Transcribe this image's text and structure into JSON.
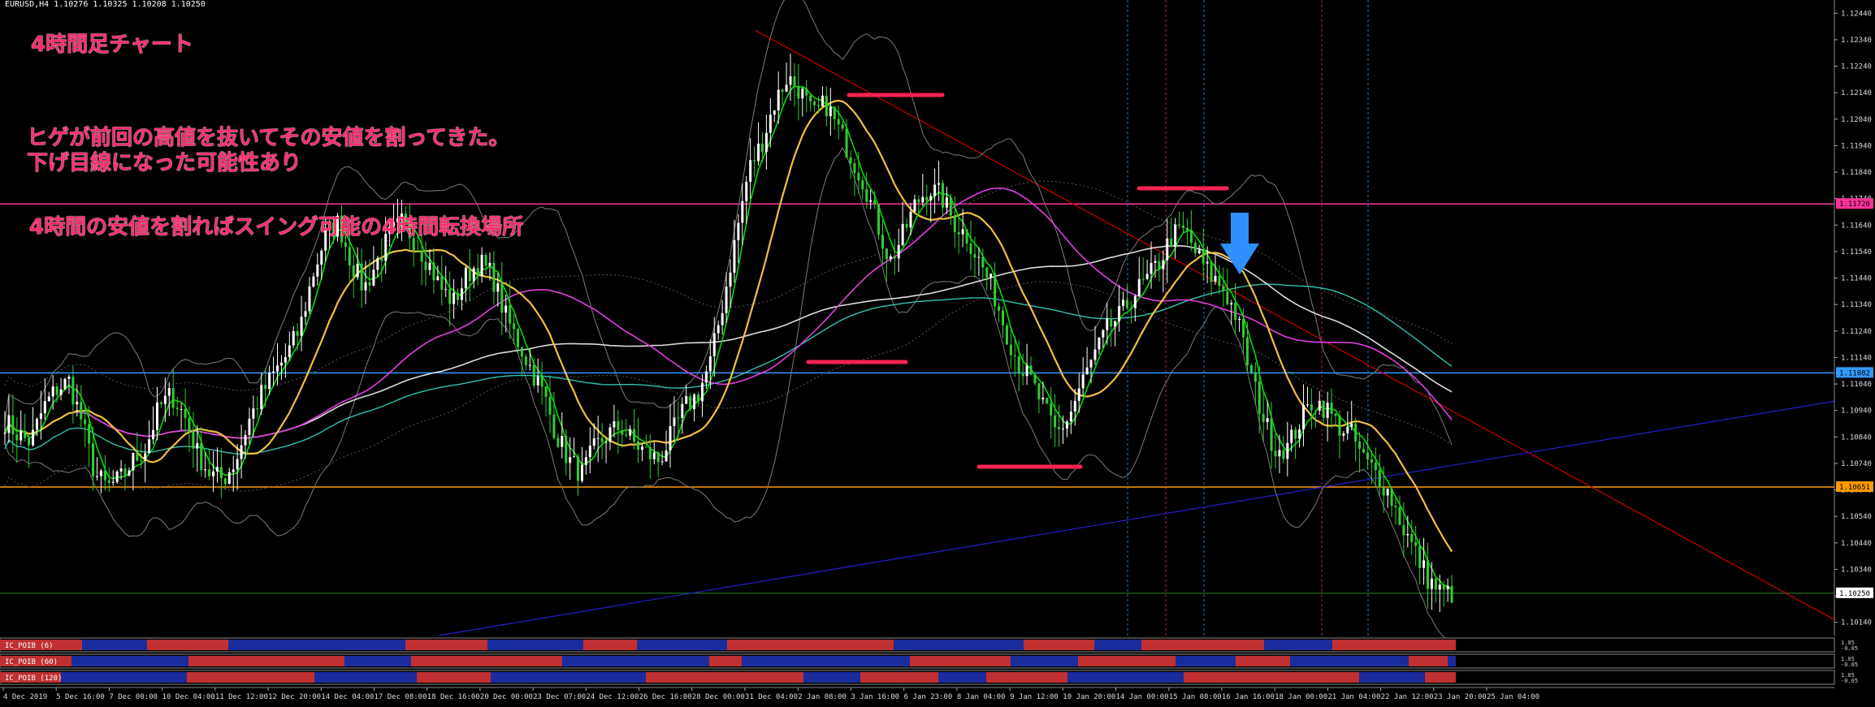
{
  "header": {
    "symbol_line": "EURUSD,H4  1.10276 1.10325 1.10208 1.10250"
  },
  "annotations": {
    "title": "4時間足チャート",
    "line1": "ヒゲが前回の高値を抜いてその安値を割ってきた。",
    "line2": "下げ目線になった可能性あり",
    "line3": "4時間の安値を割ればスイング可能の4時間転換場所"
  },
  "colors": {
    "bull": "#ffffff",
    "bear": "#33cc33",
    "ma_fast": "#00dd00",
    "ma_mid": "#f0c040",
    "ma_magenta": "#e040e0",
    "ma_white": "#dddddd",
    "ma_teal": "#30c0b0",
    "band": "#7a7a7a",
    "level_pink": "#ff3399",
    "level_blue": "#3399ff",
    "level_orange": "#ff9900",
    "trend_red": "#cc0000",
    "trend_blue": "#2222cc",
    "marker": "#ff2255",
    "arrow": "#2f8fff",
    "grid_dash_blue": "#2277bb",
    "grid_dash_red": "#bb2244",
    "indicator_red": "#c03030",
    "indicator_blue": "#1a2c9c"
  },
  "price_levels": [
    {
      "label": "1.11720",
      "color": "#ff3399"
    },
    {
      "label": "1.11082",
      "color": "#3399ff"
    },
    {
      "label": "1.10651",
      "color": "#ff9900"
    },
    {
      "label": "1.10250",
      "color": "#ffffff"
    }
  ],
  "y_ticks": [
    "1.12440",
    "1.12340",
    "1.12240",
    "1.12140",
    "1.12040",
    "1.11940",
    "1.11840",
    "1.11740",
    "1.11640",
    "1.11540",
    "1.11440",
    "1.11340",
    "1.11240",
    "1.11140",
    "1.11040",
    "1.10940",
    "1.10840",
    "1.10740",
    "1.10640",
    "1.10540",
    "1.10440",
    "1.10340",
    "1.10240",
    "1.10140"
  ],
  "x_ticks": [
    "4 Dec 2019",
    "5 Dec 16:00",
    "7 Dec 00:00",
    "10 Dec 04:00",
    "11 Dec 12:00",
    "12 Dec 20:00",
    "14 Dec 04:00",
    "17 Dec 08:00",
    "18 Dec 16:00",
    "20 Dec 00:00",
    "23 Dec 07:00",
    "24 Dec 12:00",
    "26 Dec 16:00",
    "28 Dec 00:00",
    "31 Dec 04:00",
    "2 Jan 08:00",
    "3 Jan 16:00",
    "6 Jan 23:00",
    "8 Jan 04:00",
    "9 Jan 12:00",
    "10 Jan 20:00",
    "14 Jan 00:00",
    "15 Jan 08:00",
    "16 Jan 16:00",
    "18 Jan 00:00",
    "21 Jan 04:00",
    "22 Jan 12:00",
    "23 Jan 20:00",
    "25 Jan 04:00"
  ],
  "indicators": [
    {
      "name": "IC_POIB (6)",
      "scale": [
        "1.05",
        "0.00",
        "-0.05"
      ]
    },
    {
      "name": "IC_POIB (60)",
      "scale": [
        "1.05",
        "0.00",
        "-0.05"
      ]
    },
    {
      "name": "IC_POIB (120)",
      "scale": [
        "1.05",
        "0.00",
        "-0.05"
      ]
    }
  ],
  "chart_data": {
    "type": "candlestick",
    "title": "EURUSD,H4",
    "ylim": [
      1.1009,
      1.1249
    ],
    "close_series": [
      1.109,
      1.1085,
      1.1082,
      1.1095,
      1.1102,
      1.1105,
      1.109,
      1.107,
      1.1065,
      1.1068,
      1.1075,
      1.108,
      1.1095,
      1.11,
      1.1092,
      1.1078,
      1.107,
      1.1068,
      1.1075,
      1.109,
      1.11,
      1.1108,
      1.1115,
      1.1125,
      1.1145,
      1.116,
      1.1165,
      1.115,
      1.114,
      1.115,
      1.116,
      1.1165,
      1.1158,
      1.115,
      1.114,
      1.1135,
      1.1145,
      1.115,
      1.1145,
      1.113,
      1.112,
      1.111,
      1.11,
      1.1085,
      1.1075,
      1.107,
      1.108,
      1.1085,
      1.1088,
      1.1082,
      1.1078,
      1.1075,
      1.1085,
      1.1095,
      1.11,
      1.1112,
      1.1135,
      1.116,
      1.1185,
      1.1195,
      1.121,
      1.122,
      1.1215,
      1.1205,
      1.121,
      1.12,
      1.119,
      1.118,
      1.1165,
      1.115,
      1.116,
      1.1172,
      1.1178,
      1.1175,
      1.1165,
      1.116,
      1.115,
      1.114,
      1.1125,
      1.1112,
      1.1105,
      1.1095,
      1.1085,
      1.1092,
      1.1105,
      1.1115,
      1.1125,
      1.113,
      1.1138,
      1.1143,
      1.115,
      1.116,
      1.1162,
      1.1152,
      1.1145,
      1.114,
      1.113,
      1.111,
      1.1093,
      1.108,
      1.108,
      1.109,
      1.1098,
      1.1095,
      1.1088,
      1.1085,
      1.1075,
      1.107,
      1.1062,
      1.105,
      1.104,
      1.103,
      1.1025
    ]
  }
}
